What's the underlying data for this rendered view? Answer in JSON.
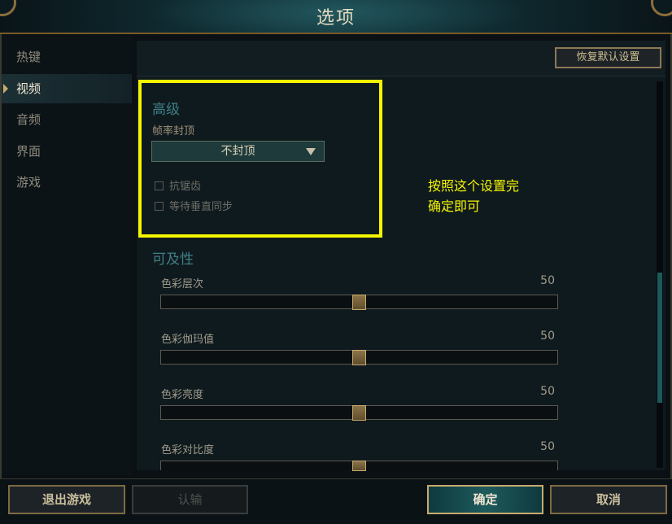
{
  "window": {
    "title": "选项"
  },
  "sidebar": {
    "items": [
      {
        "label": "热键",
        "active": false
      },
      {
        "label": "视频",
        "active": true
      },
      {
        "label": "音频",
        "active": false
      },
      {
        "label": "界面",
        "active": false
      },
      {
        "label": "游戏",
        "active": false
      }
    ]
  },
  "toolbar": {
    "reset_label": "恢复默认设置"
  },
  "advanced": {
    "title": "高级",
    "frame_cap_label": "帧率封顶",
    "frame_cap_value": "不封顶",
    "checkboxes": [
      {
        "label": "抗锯齿",
        "checked": false
      },
      {
        "label": "等待垂直同步",
        "checked": false
      }
    ]
  },
  "annotation": {
    "line1": "按照这个设置完",
    "line2": "确定即可",
    "color": "#f5f500"
  },
  "accessibility": {
    "title": "可及性",
    "sliders": [
      {
        "label": "色彩层次",
        "value": "50",
        "level": 0.5
      },
      {
        "label": "色彩伽玛值",
        "value": "50",
        "level": 0.5
      },
      {
        "label": "色彩亮度",
        "value": "50",
        "level": 0.5
      },
      {
        "label": "色彩对比度",
        "value": "50",
        "level": 0.5
      }
    ]
  },
  "footer": {
    "quit_label": "退出游戏",
    "surrender_label": "认输",
    "confirm_label": "确定",
    "cancel_label": "取消"
  },
  "colors": {
    "accent_gold": "#c8aa6e",
    "teal": "#1e5a5c",
    "highlight": "#f5f500"
  }
}
